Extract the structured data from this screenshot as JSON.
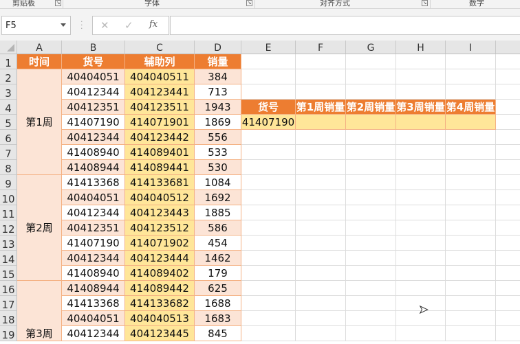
{
  "ribbon": {
    "groups": [
      "剪贴板",
      "字体",
      "对齐方式",
      "数字"
    ]
  },
  "formula_bar": {
    "name_box": "F5",
    "cancel_icon": "✕",
    "enter_icon": "✓",
    "fx_label": "fx",
    "value": ""
  },
  "columns": [
    "A",
    "B",
    "C",
    "D",
    "E",
    "F",
    "G",
    "H",
    "I"
  ],
  "rows": [
    "1",
    "2",
    "3",
    "4",
    "5",
    "6",
    "7",
    "8",
    "9",
    "10",
    "11",
    "12",
    "13",
    "14",
    "15",
    "16",
    "17",
    "18",
    "19"
  ],
  "table": {
    "headers": [
      "时间",
      "货号",
      "辅助列",
      "销量"
    ],
    "weeks": [
      "第1周",
      "第2周",
      "第3周"
    ],
    "data": [
      [
        "40404051",
        "404040511",
        "384"
      ],
      [
        "40412344",
        "404123441",
        "713"
      ],
      [
        "40412351",
        "404123511",
        "1943"
      ],
      [
        "41407190",
        "414071901",
        "1869"
      ],
      [
        "40412344",
        "404123442",
        "556"
      ],
      [
        "41408940",
        "414089401",
        "533"
      ],
      [
        "41408944",
        "414089441",
        "530"
      ],
      [
        "41413368",
        "414133681",
        "1084"
      ],
      [
        "40404051",
        "404040512",
        "1692"
      ],
      [
        "40412344",
        "404123443",
        "1885"
      ],
      [
        "40412351",
        "404123512",
        "586"
      ],
      [
        "41407190",
        "414071902",
        "454"
      ],
      [
        "40412344",
        "404123444",
        "1462"
      ],
      [
        "41408940",
        "414089402",
        "179"
      ],
      [
        "41408944",
        "414089442",
        "625"
      ],
      [
        "41413368",
        "414133682",
        "1688"
      ],
      [
        "40404051",
        "404040513",
        "1683"
      ],
      [
        "40412344",
        "404123445",
        "845"
      ]
    ]
  },
  "lookup": {
    "headers": [
      "货号",
      "第1周销量",
      "第2周销量",
      "第3周销量",
      "第4周销量"
    ],
    "values": [
      "41407190",
      "",
      "",
      "",
      ""
    ]
  },
  "colors": {
    "header": "#ed7d31",
    "pink": "#fce4d6",
    "yellow": "#ffe699"
  }
}
